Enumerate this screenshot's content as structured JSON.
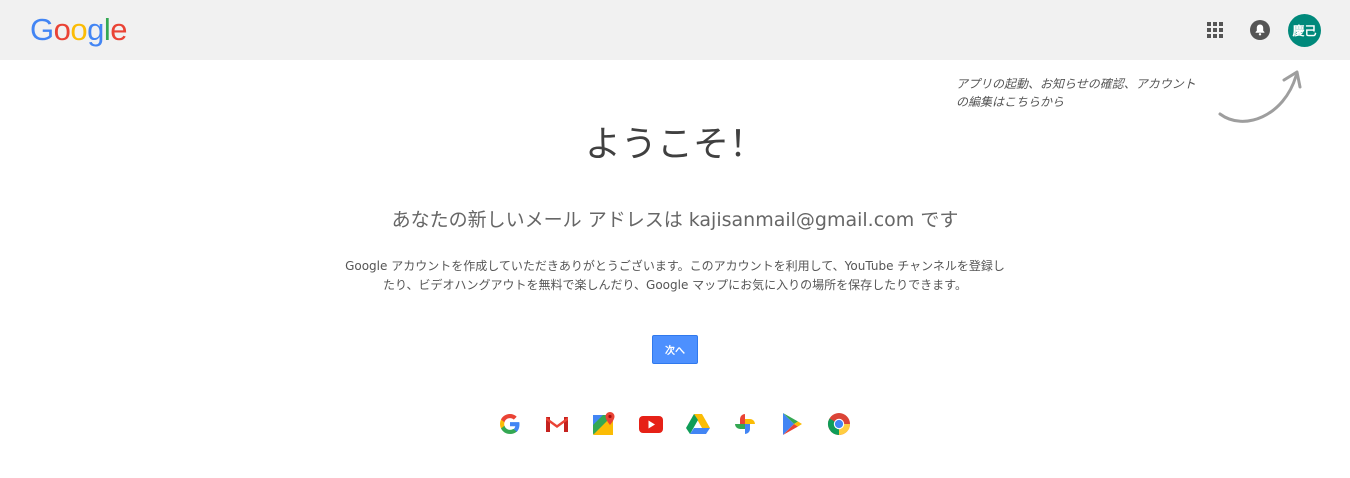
{
  "header": {
    "logo_letters": [
      {
        "ch": "G",
        "color": "#4285f4"
      },
      {
        "ch": "o",
        "color": "#ea4335"
      },
      {
        "ch": "o",
        "color": "#fbbc05"
      },
      {
        "ch": "g",
        "color": "#4285f4"
      },
      {
        "ch": "l",
        "color": "#34a853"
      },
      {
        "ch": "e",
        "color": "#ea4335"
      }
    ],
    "apps_icon": "apps-grid-icon",
    "notifications_icon": "bell-icon",
    "avatar_text": "慶己",
    "avatar_color": "#00897b"
  },
  "hint": {
    "text": "アプリの起動、お知らせの確認、アカウントの編集はこちらから"
  },
  "main": {
    "title": "ようこそ！",
    "address_line": "あなたの新しいメール アドレスは kajisanmail@gmail.com です",
    "description": "Google アカウントを作成していただきありがとうございます。このアカウントを利用して、YouTube チャンネルを登録したり、ビデオハングアウトを無料で楽しんだり、Google マップにお気に入りの場所を保存したりできます。",
    "next_button": "次へ"
  },
  "products": [
    {
      "name": "google-search-icon"
    },
    {
      "name": "gmail-icon"
    },
    {
      "name": "maps-icon"
    },
    {
      "name": "youtube-icon"
    },
    {
      "name": "drive-icon"
    },
    {
      "name": "photos-icon"
    },
    {
      "name": "play-store-icon"
    },
    {
      "name": "chrome-icon"
    }
  ],
  "colors": {
    "header_bg": "#f1f1f1",
    "button_blue": "#4d90fe"
  }
}
